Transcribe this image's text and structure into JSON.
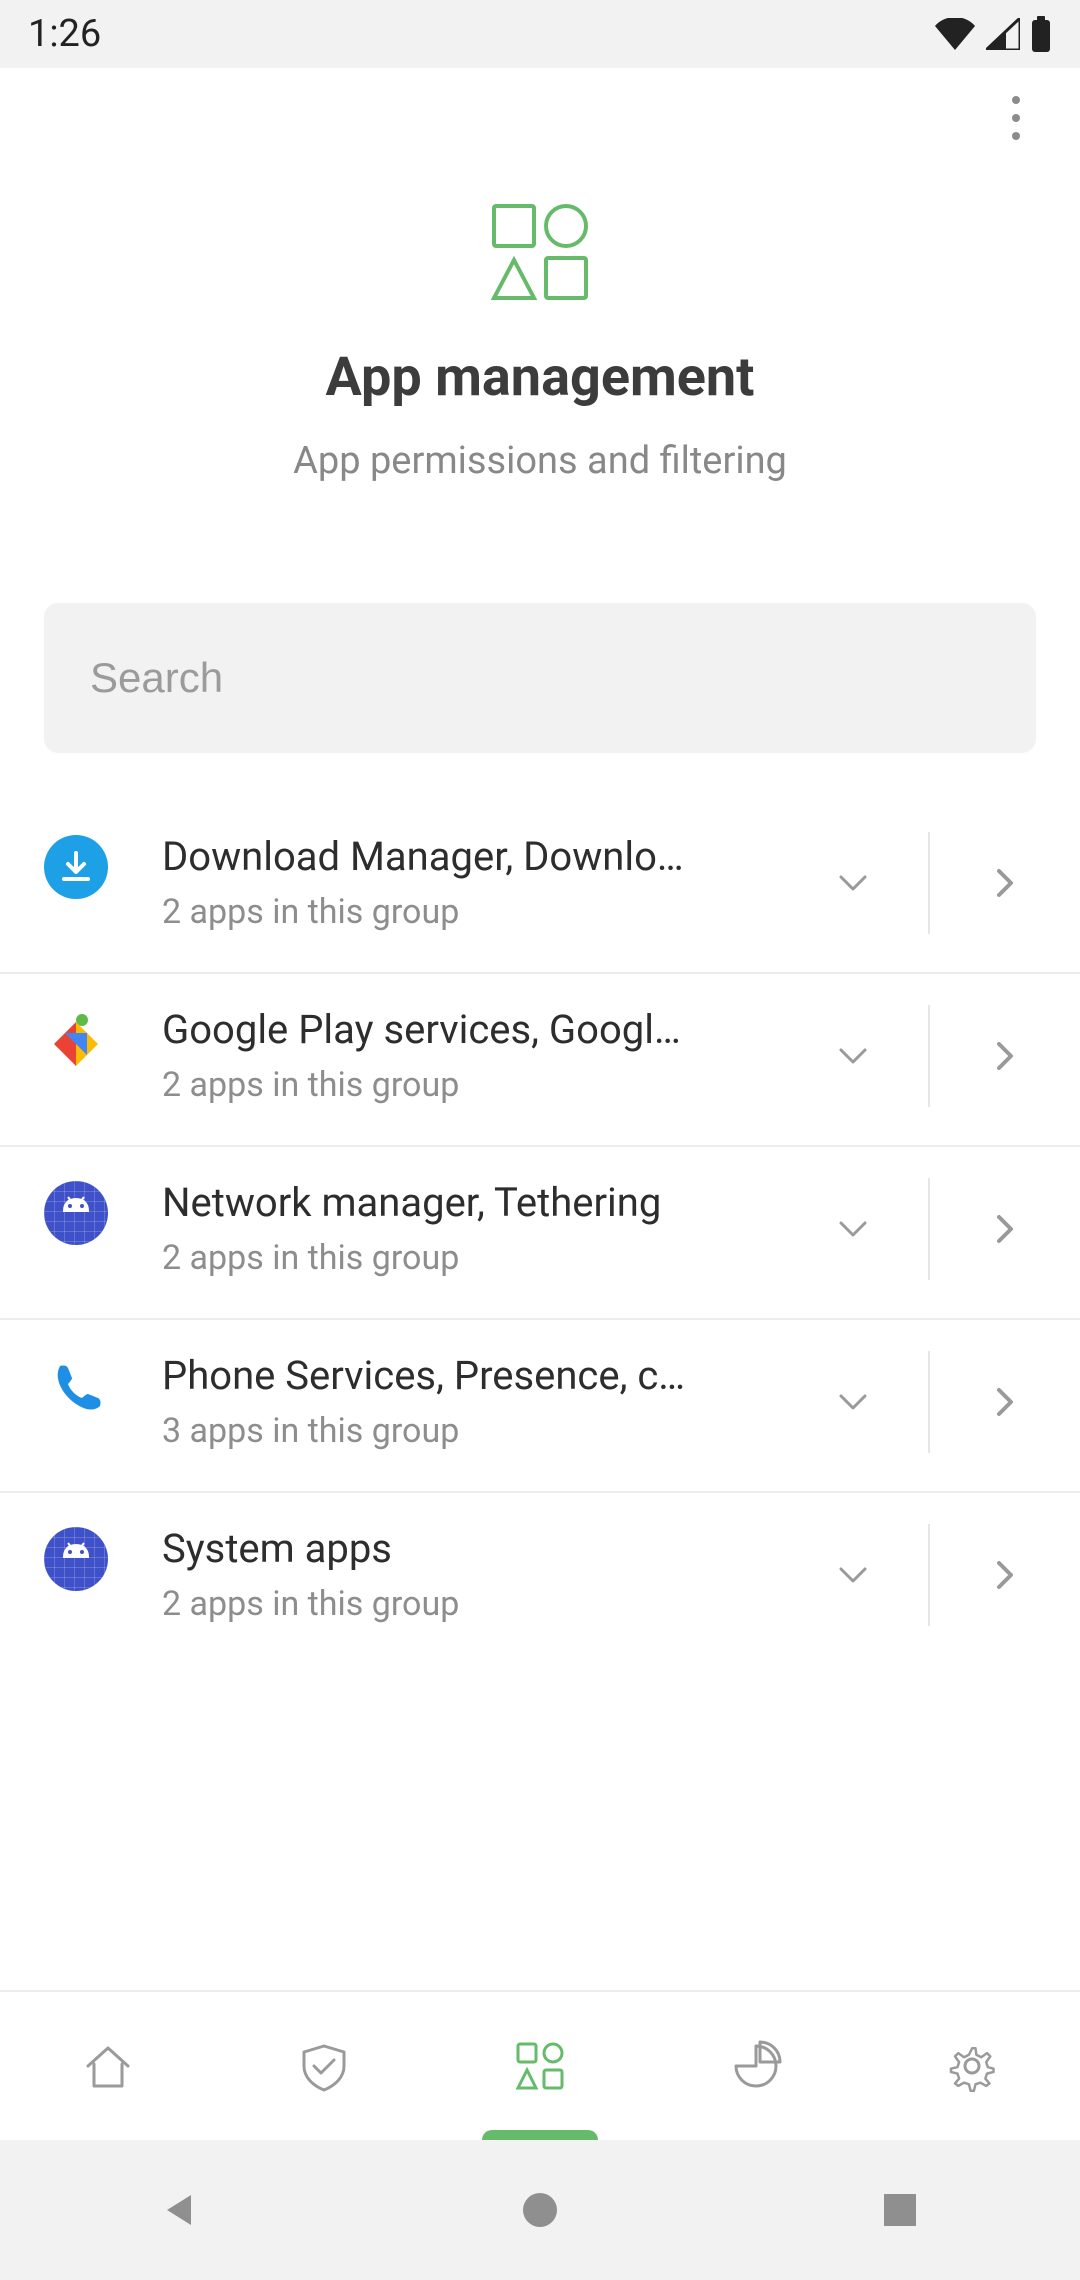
{
  "statusbar": {
    "time": "1:26"
  },
  "header": {
    "title": "App management",
    "subtitle": "App permissions and filtering"
  },
  "search": {
    "placeholder": "Search"
  },
  "groups": [
    {
      "title": "Download Manager, Downlo…",
      "subtitle": "2 apps in this group",
      "icon": "download"
    },
    {
      "title": "Google Play services, Googl…",
      "subtitle": "2 apps in this group",
      "icon": "play"
    },
    {
      "title": "Network manager, Tethering",
      "subtitle": "2 apps in this group",
      "icon": "android"
    },
    {
      "title": "Phone Services, Presence, c…",
      "subtitle": "3 apps in this group",
      "icon": "phone"
    },
    {
      "title": "System apps",
      "subtitle": "2 apps in this group",
      "icon": "android"
    }
  ],
  "nav": {
    "items": [
      "home",
      "protection",
      "apps",
      "statistics",
      "settings"
    ],
    "active": "apps"
  },
  "colors": {
    "accent": "#66bb6a"
  }
}
